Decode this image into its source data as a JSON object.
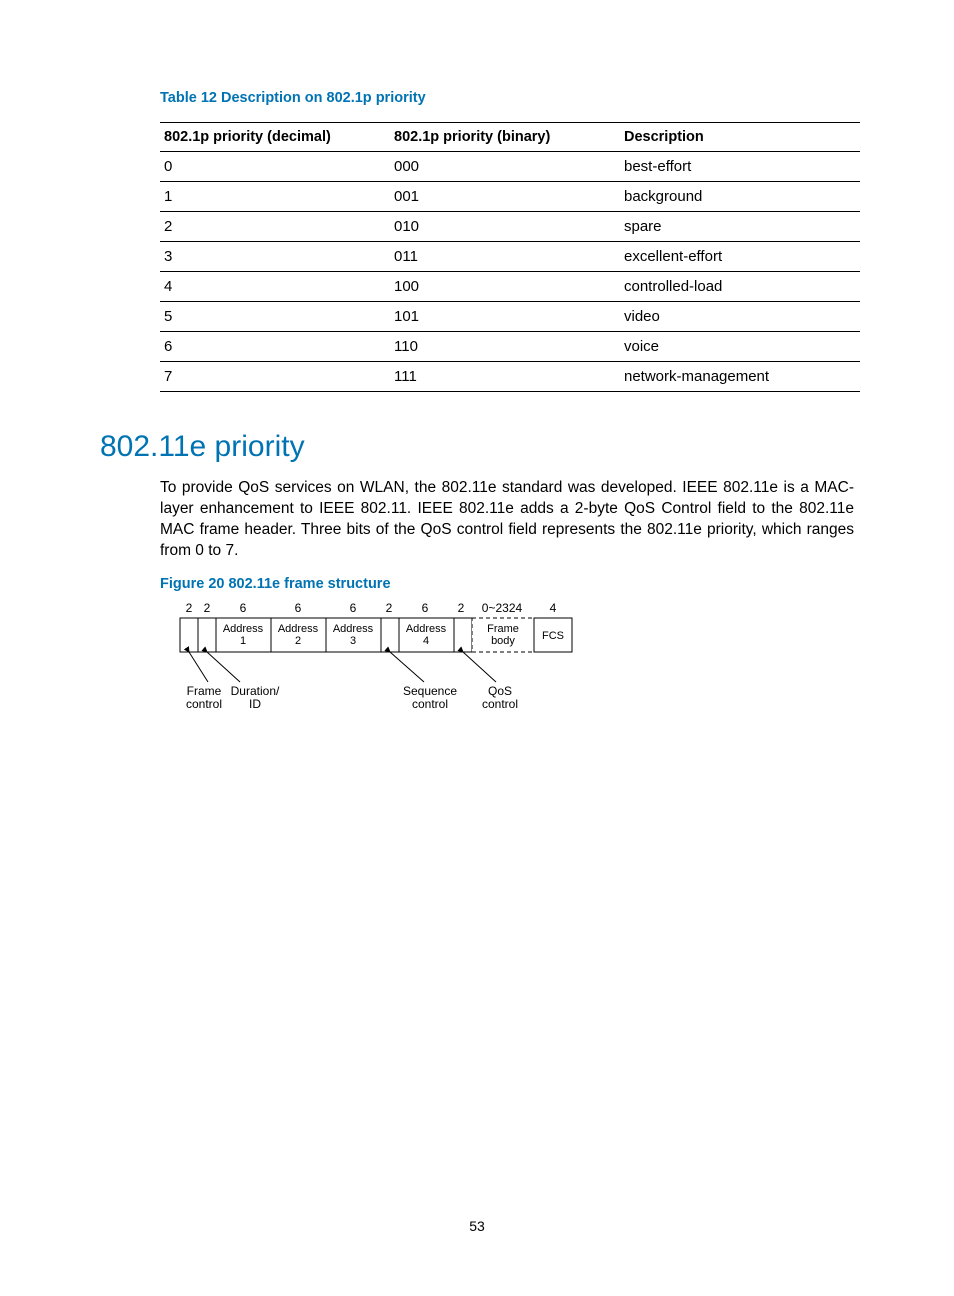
{
  "table_caption": "Table 12 Description on 802.1p priority",
  "table": {
    "headers": [
      "802.1p priority (decimal)",
      "802.1p priority (binary)",
      "Description"
    ],
    "rows": [
      {
        "c0": "0",
        "c1": "000",
        "c2": "best-effort"
      },
      {
        "c0": "1",
        "c1": "001",
        "c2": "background"
      },
      {
        "c0": "2",
        "c1": "010",
        "c2": "spare"
      },
      {
        "c0": "3",
        "c1": "011",
        "c2": "excellent-effort"
      },
      {
        "c0": "4",
        "c1": "100",
        "c2": "controlled-load"
      },
      {
        "c0": "5",
        "c1": "101",
        "c2": "video"
      },
      {
        "c0": "6",
        "c1": "110",
        "c2": "voice"
      },
      {
        "c0": "7",
        "c1": "111",
        "c2": "network-management"
      }
    ]
  },
  "section_heading": "802.11e priority",
  "body_paragraph": "To provide QoS services on WLAN, the 802.11e standard was developed. IEEE 802.11e is a MAC-layer enhancement to IEEE 802.11. IEEE 802.11e adds a 2-byte QoS Control field to the 802.11e MAC frame header. Three bits of the QoS control field represents the 802.11e priority, which ranges from 0 to 7.",
  "figure_caption": "Figure 20 802.11e frame structure",
  "frame": {
    "widths": [
      "2",
      "2",
      "6",
      "6",
      "6",
      "2",
      "6",
      "2",
      "0~2324",
      "4"
    ],
    "labels": [
      "",
      "",
      "Address 1",
      "Address 2",
      "Address 3",
      "",
      "Address 4",
      "",
      "Frame body",
      "FCS"
    ],
    "callouts": {
      "frame_control": "Frame control",
      "duration_id": "Duration/ ID",
      "sequence_control": "Sequence control",
      "qos_control": "QoS control"
    }
  },
  "page_number": "53"
}
